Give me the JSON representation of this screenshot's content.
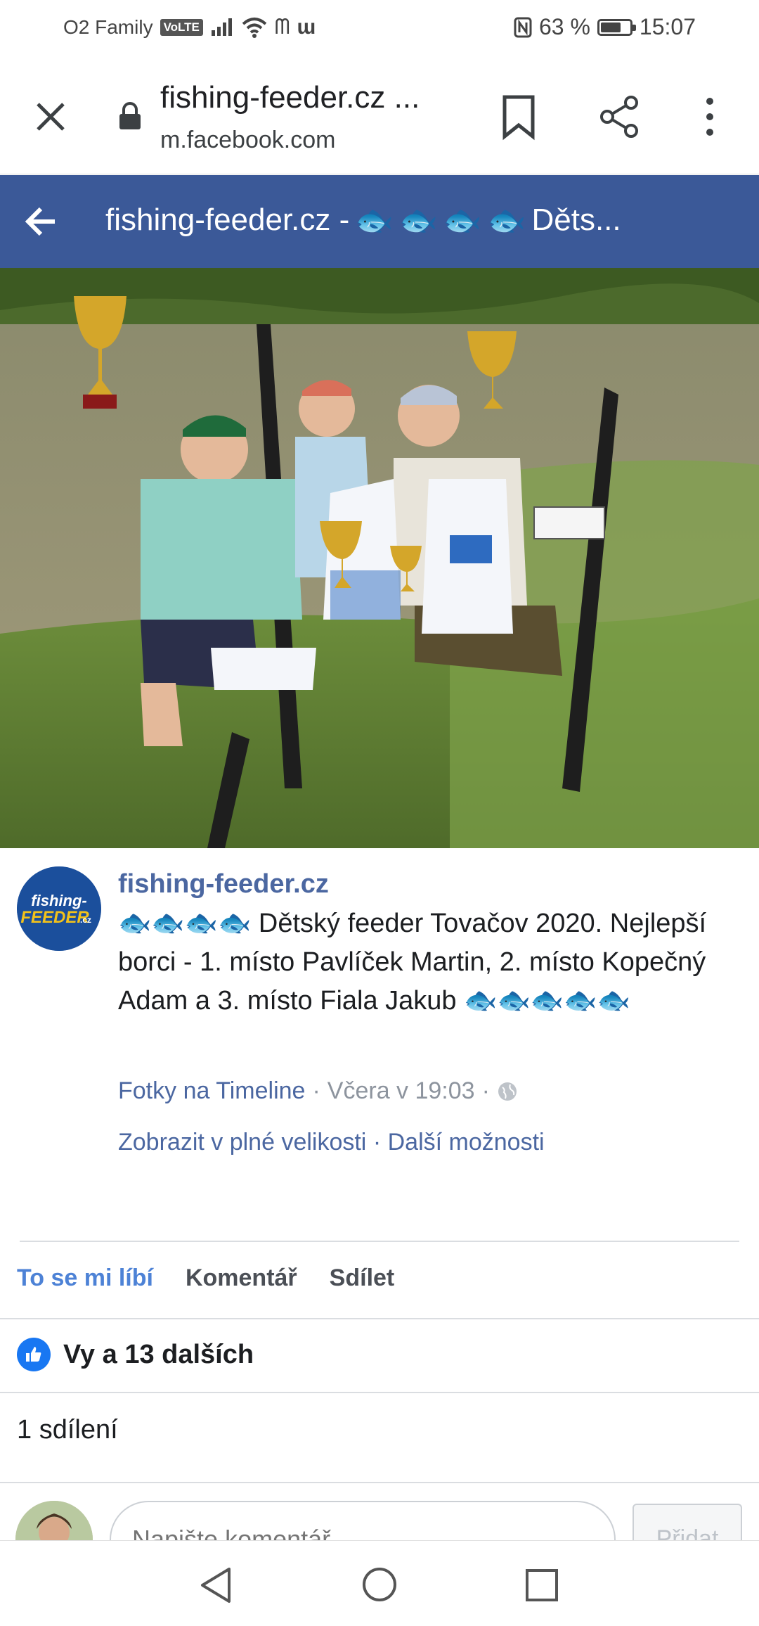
{
  "status_bar": {
    "carrier": "O2 Family",
    "volte": "VoLTE",
    "battery": "63 %",
    "time": "15:07",
    "battery_level": 0.63
  },
  "browser": {
    "page_title": "fishing-feeder.cz ...",
    "domain": "m.facebook.com"
  },
  "fb_header": {
    "title_prefix": "fishing-feeder.cz -",
    "title_suffix": "Děts..."
  },
  "post": {
    "page_name": "fishing-feeder.cz",
    "caption": "Dětský feeder Tovačov 2020. Nejlepší borci - 1. místo Pavlíček Martin, 2. místo Kopečný Adam a 3. místo Fiala Jakub",
    "emoji": "🐟",
    "meta_link": "Fotky na Timeline",
    "meta_time": "Včera v 19:03",
    "meta_sep": "·",
    "opt_full_size": "Zobrazit v plné velikosti",
    "opt_more": "Další možnosti"
  },
  "actions": {
    "like": "To se mi líbí",
    "comment": "Komentář",
    "share": "Sdílet"
  },
  "reactions": {
    "text": "Vy a 13 dalších"
  },
  "shares": {
    "text": "1 sdílení"
  },
  "comment": {
    "placeholder": "Napište komentář...",
    "post_button": "Přidat"
  },
  "avatar_logo": {
    "line1": "fishing-",
    "line2": "FEEDER",
    "suffix": ".cz"
  },
  "colors": {
    "fb_blue": "#3b5998",
    "link_blue": "#4b67a1",
    "like_blue": "#4d82d6"
  }
}
